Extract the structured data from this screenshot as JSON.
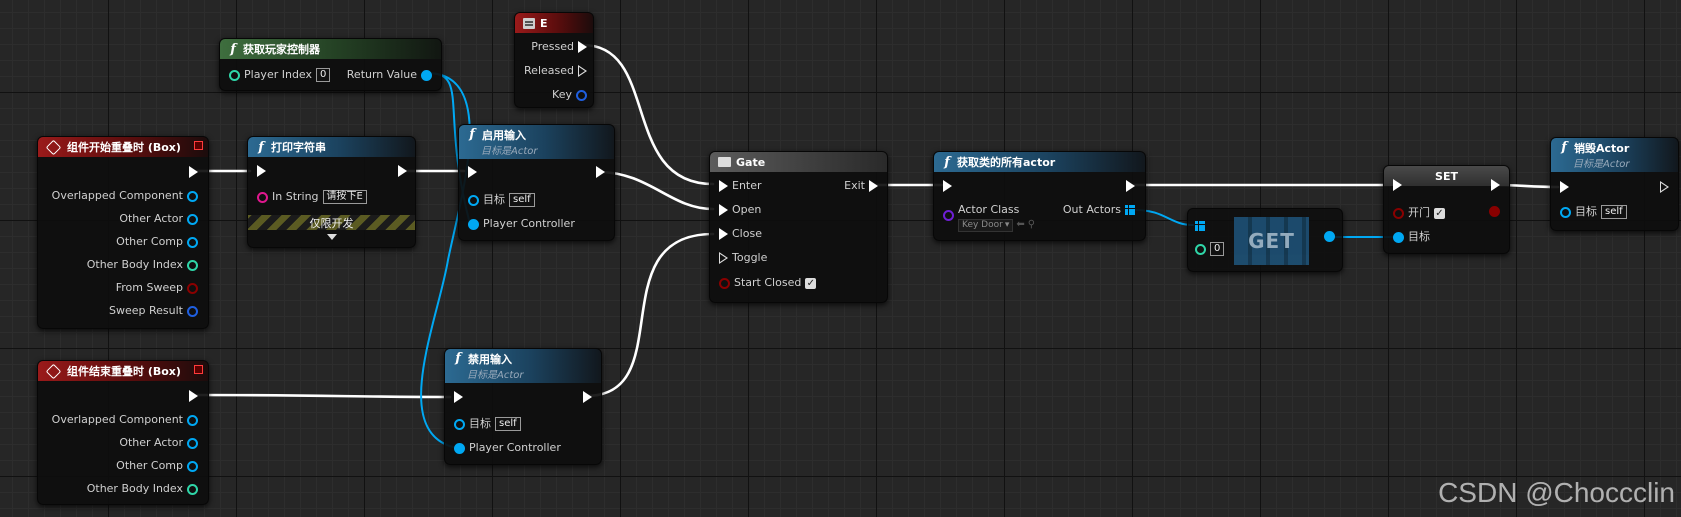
{
  "nodes": {
    "begin_overlap": {
      "title": "组件开始重叠时 (Box)",
      "pins": [
        "Overlapped Component",
        "Other Actor",
        "Other Comp",
        "Other Body Index",
        "From Sweep",
        "Sweep Result"
      ]
    },
    "end_overlap": {
      "title": "组件结束重叠时 (Box)",
      "pins": [
        "Overlapped Component",
        "Other Actor",
        "Other Comp",
        "Other Body Index"
      ]
    },
    "get_player_controller": {
      "title": "获取玩家控制器",
      "player_index_label": "Player Index",
      "player_index_value": "0",
      "return_value_label": "Return Value"
    },
    "print_string": {
      "title": "打印字符串",
      "in_string_label": "In String",
      "in_string_value": "请按下E",
      "dev_only": "仅限开发"
    },
    "key_e": {
      "title": "E",
      "pressed": "Pressed",
      "released": "Released",
      "key": "Key"
    },
    "enable_input": {
      "title": "启用输入",
      "subtitle": "目标是Actor",
      "target_label": "目标",
      "target_value": "self",
      "player_controller": "Player Controller"
    },
    "disable_input": {
      "title": "禁用输入",
      "subtitle": "目标是Actor",
      "target_label": "目标",
      "target_value": "self",
      "player_controller": "Player Controller"
    },
    "gate": {
      "title": "Gate",
      "enter": "Enter",
      "exit": "Exit",
      "open": "Open",
      "close": "Close",
      "toggle": "Toggle",
      "start_closed": "Start Closed",
      "start_closed_checked": true
    },
    "get_all_actors": {
      "title": "获取类的所有actor",
      "actor_class_label": "Actor Class",
      "actor_class_value": "Key Door",
      "out_actors": "Out Actors"
    },
    "get_array": {
      "title": "GET",
      "index_value": "0"
    },
    "set_node": {
      "title": "SET",
      "var_label": "开门",
      "var_checked": true,
      "target_label": "目标"
    },
    "destroy_actor": {
      "title": "销毁Actor",
      "subtitle": "目标是Actor",
      "target_label": "目标",
      "target_value": "self"
    }
  },
  "colors": {
    "event_header": "#9a1a1a",
    "pure_header": "#3e6e3e",
    "function_header": "#2c6a92",
    "object_pin": "#00a8f3",
    "int_pin": "#2fd6a8",
    "bool_pin": "#8a0000",
    "struct_pin": "#1f5fe0",
    "class_pin": "#6e1fd4",
    "string_pin": "#e0178e"
  },
  "watermark": "CSDN @Choccclin"
}
